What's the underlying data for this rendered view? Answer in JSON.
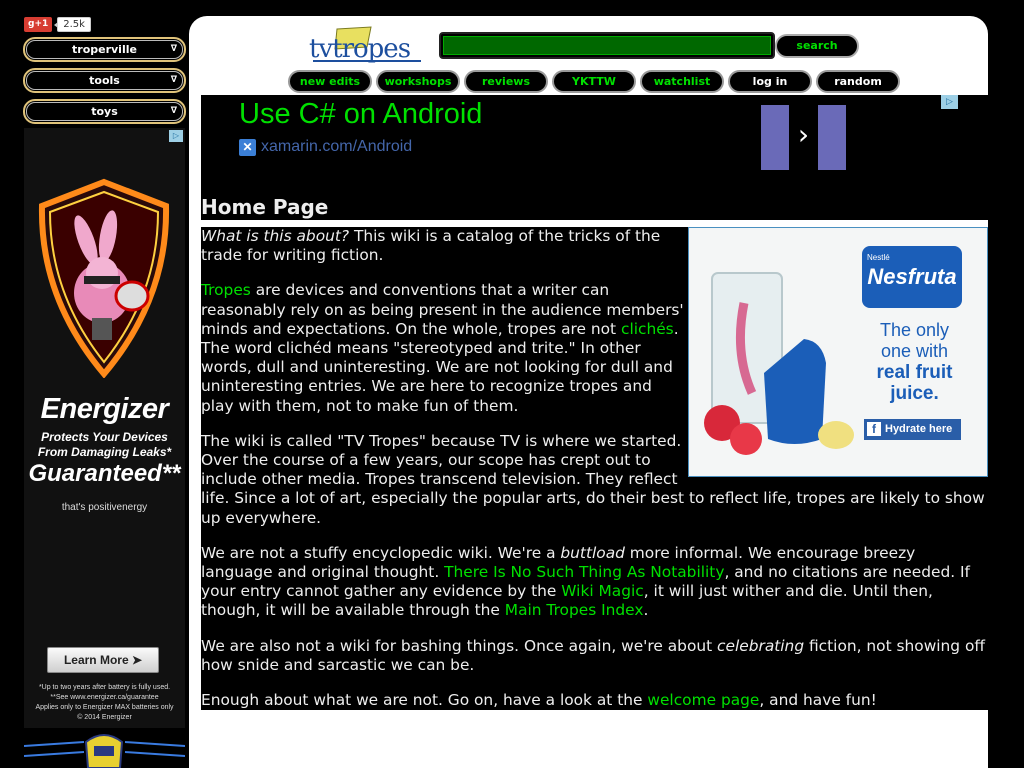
{
  "gplus": {
    "label": "g+1",
    "count": "2.5k"
  },
  "sidebar": {
    "menus": [
      {
        "label": "troperville",
        "caret": "∇"
      },
      {
        "label": "tools",
        "caret": "∇"
      },
      {
        "label": "toys",
        "caret": "∇"
      }
    ]
  },
  "left_ad": {
    "adchoices": "▷",
    "title": "Energizer",
    "sub_line1": "Protects Your Devices",
    "sub_line2": "From Damaging Leaks*",
    "guarantee": "Guaranteed**",
    "tagline": "that's positivenergy",
    "cta": "Learn More  ➤",
    "fine1": "*Up to two years after battery is fully used.",
    "fine2": "**See www.energizer.ca/guarantee",
    "fine3": "Applies only to Energizer MAX batteries only",
    "fine4": "© 2014 Energizer"
  },
  "header": {
    "logo": "tvtropes",
    "search_label": "search",
    "nav": [
      {
        "label": "new edits"
      },
      {
        "label": "workshops"
      },
      {
        "label": "reviews"
      },
      {
        "label": "YKTTW"
      },
      {
        "label": "watchlist"
      },
      {
        "label": "log in"
      },
      {
        "label": "random"
      }
    ]
  },
  "top_ad": {
    "headline": "Use C# on Android",
    "url": "xamarin.com/Android",
    "adchoices": "▷"
  },
  "page": {
    "title": "Home Page",
    "p1_em": "What is this about?",
    "p1_text": " This wiki is a catalog of the tricks of the trade for writing fiction.",
    "p2_link1": "Tropes",
    "p2_text1": " are devices and conventions that a writer can reasonably rely on as being present in the audience members' minds and expectations. On the whole, tropes are not ",
    "p2_link2": "clichés",
    "p2_text2": ". The word clichéd means \"stereotyped and trite.\" In other words, dull and uninteresting. We are not looking for dull and uninteresting entries. We are here to recognize tropes and play with them, not to make fun of them.",
    "p3_text": "The wiki is called \"TV Tropes\" because TV is where we started. Over the course of a few years, our scope has crept out to include other media. Tropes transcend television. They reflect life. Since a lot of art, especially the popular arts, do their best to reflect life, tropes are likely to show up everywhere.",
    "p4_text1": "We are not a stuffy encyclopedic wiki. We're a ",
    "p4_em": "buttload",
    "p4_text2": " more informal. We encourage breezy language and original thought. ",
    "p4_link1": "There Is No Such Thing As Notability",
    "p4_text3": ", and no citations are needed. If your entry cannot gather any evidence by the ",
    "p4_link2": "Wiki Magic",
    "p4_text4": ", it will just wither and die. Until then, though, it will be available through the ",
    "p4_link3": "Main Tropes Index",
    "p4_text5": ".",
    "p5_text1": "We are also not a wiki for bashing things. Once again, we're about ",
    "p5_em": "celebrating",
    "p5_text2": " fiction, not showing off how snide and sarcastic we can be.",
    "p6_text1": "Enough about what we are not. Go on, have a look at the ",
    "p6_link": "welcome page",
    "p6_text2": ", and have fun!"
  },
  "right_ad": {
    "brand_small": "Nestlé",
    "brand": "Nesfruta",
    "line1": "The only",
    "line2": "one with",
    "line3": "real fruit",
    "line4": "juice.",
    "cta": "Hydrate here",
    "cta_icon": "f"
  },
  "colors": {
    "link": "#00e000",
    "accent": "#006800",
    "page_bg": "#000000"
  }
}
